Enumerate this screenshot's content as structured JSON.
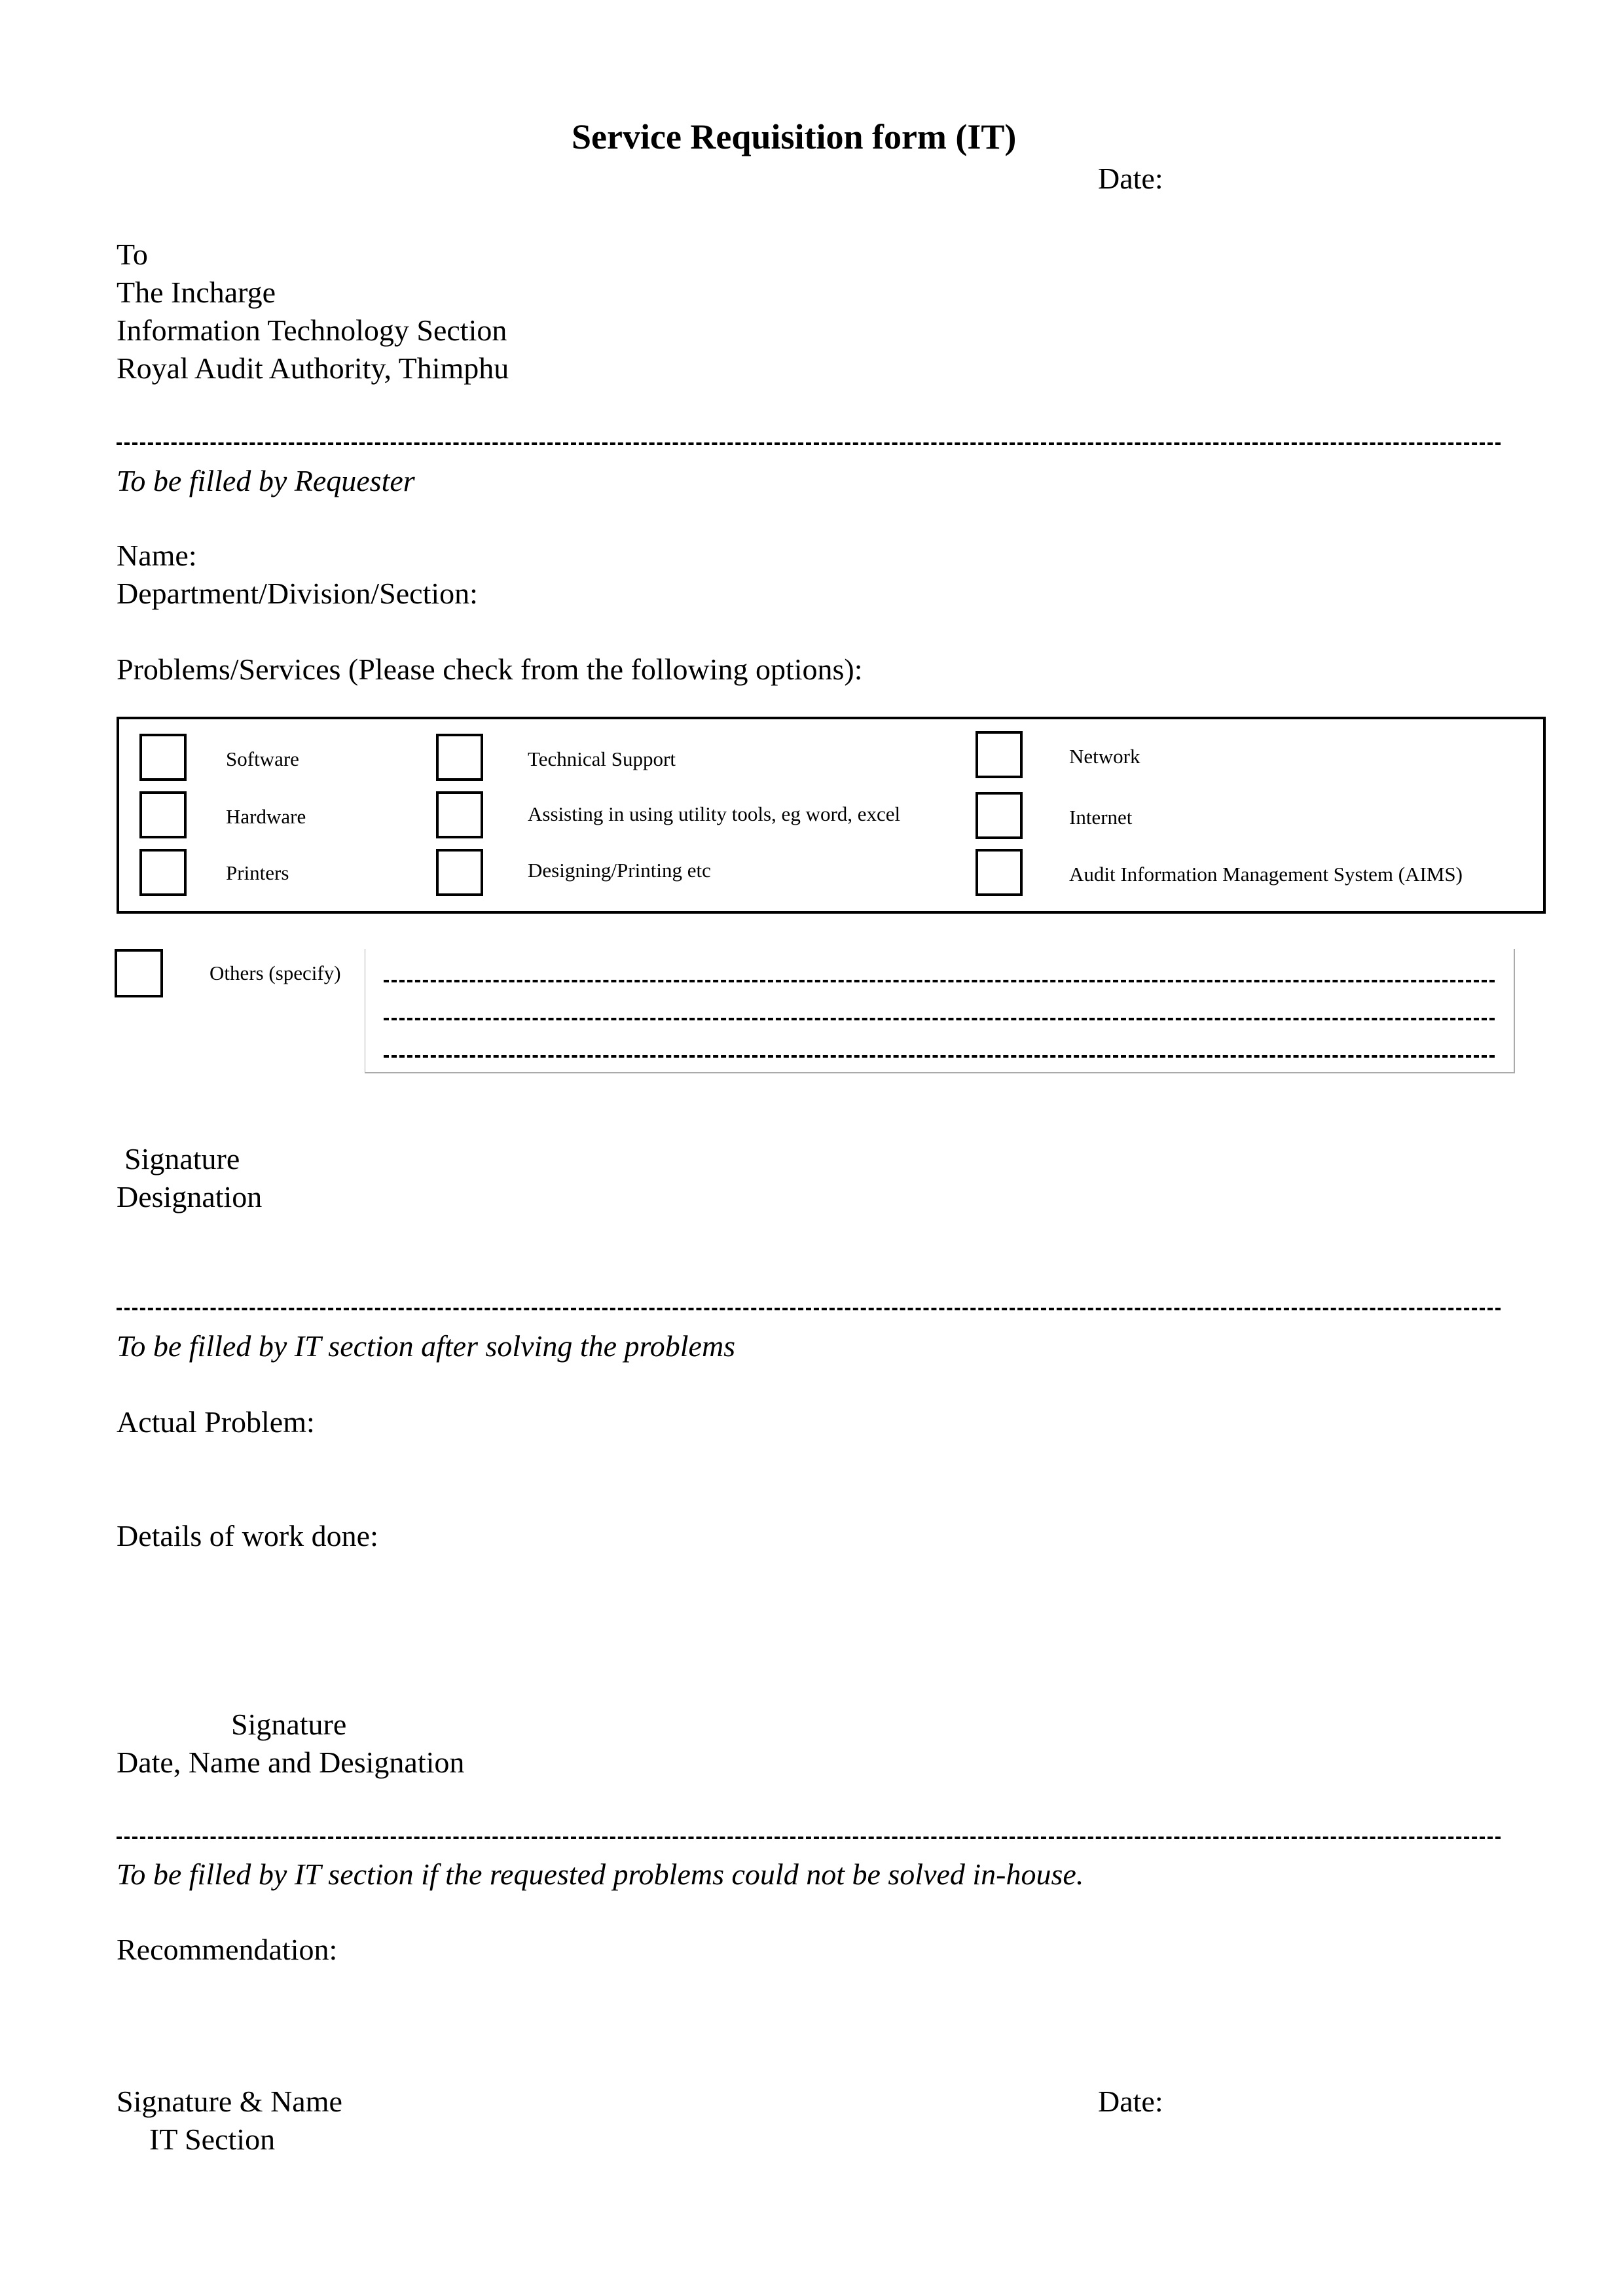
{
  "header": {
    "title": "Service Requisition form (IT)",
    "date_label": "Date:"
  },
  "address": {
    "lines": [
      "To",
      "The Incharge",
      "Information Technology Section",
      "Royal Audit Authority, Thimphu"
    ]
  },
  "requester_section": {
    "heading": "To be filled by Requester",
    "name_label": "Name:",
    "department_label": "Department/Division/Section:",
    "problems_label": "Problems/Services (Please check from the following options):",
    "options": [
      {
        "label": "Software",
        "checked": false
      },
      {
        "label": "Hardware",
        "checked": false
      },
      {
        "label": "Printers",
        "checked": false
      },
      {
        "label": "Technical Support",
        "checked": false
      },
      {
        "label": "Assisting in using utility tools, eg word, excel",
        "checked": false
      },
      {
        "label": "Designing/Printing etc",
        "checked": false
      },
      {
        "label": "Network",
        "checked": false
      },
      {
        "label": "Internet",
        "checked": false
      },
      {
        "label": "Audit Information Management System (AIMS)",
        "checked": false
      }
    ],
    "others": {
      "label": "Others (specify)",
      "checked": false,
      "lines": [
        "",
        "",
        ""
      ]
    },
    "signature_label": "Signature",
    "designation_label": "Designation"
  },
  "it_solved_section": {
    "heading": "To be filled by IT section after solving the problems",
    "actual_problem_label": "Actual Problem:",
    "details_label": "Details of work done:",
    "signature_label": "Signature",
    "date_name_designation_label": "Date, Name and Designation"
  },
  "it_unsolved_section": {
    "heading": "To be filled by IT section if the requested problems could not be solved in-house.",
    "recommendation_label": "Recommendation:",
    "signature_name_label": "Signature & Name",
    "it_section_label": "IT Section",
    "date_label": "Date:"
  }
}
